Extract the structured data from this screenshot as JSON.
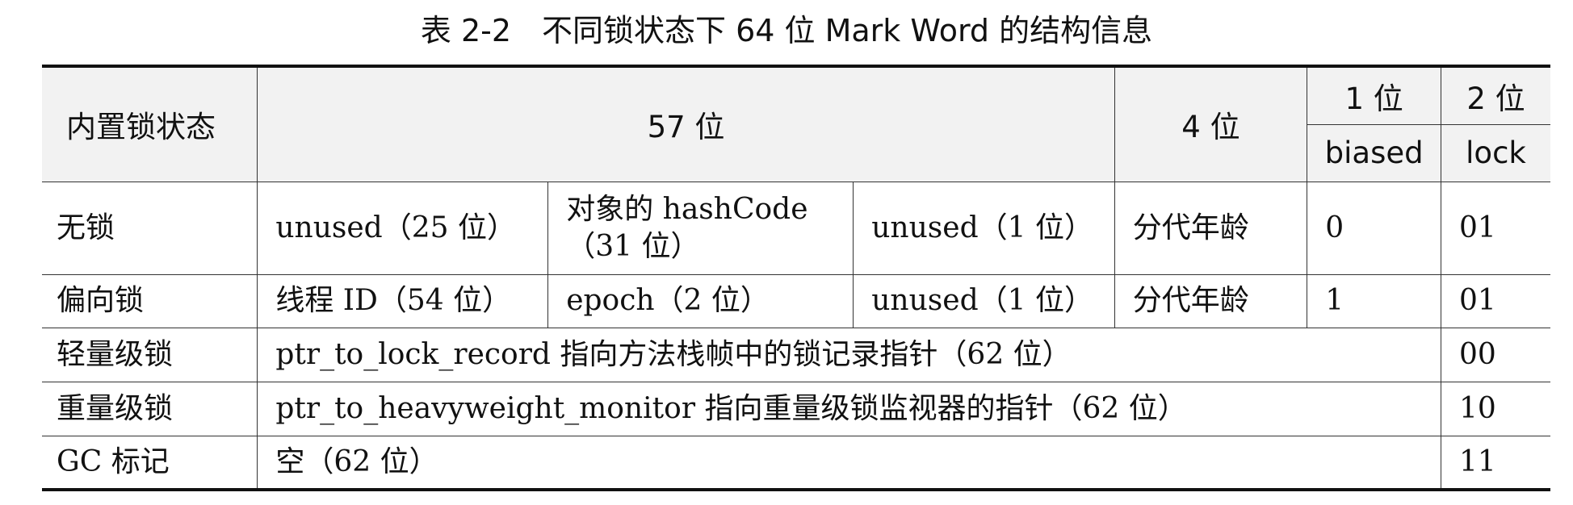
{
  "caption": "表 2-2　不同锁状态下 64 位 Mark Word 的结构信息",
  "header": {
    "state": "内置锁状态",
    "bits57": "57 位",
    "bits4": "4 位",
    "bits1": "1 位",
    "bits2": "2 位",
    "biased": "biased",
    "lock": "lock"
  },
  "rows": {
    "unlocked": {
      "state": "无锁",
      "unused25": "unused（25 位）",
      "hashcode": "对象的 hashCode（31 位）",
      "unused1": "unused（1 位）",
      "age": "分代年龄",
      "biased": "0",
      "lock": "01"
    },
    "biased": {
      "state": "偏向锁",
      "thread_id": "线程 ID（54 位）",
      "epoch": "epoch（2 位）",
      "unused1": "unused（1 位）",
      "age": "分代年龄",
      "biased": "1",
      "lock": "01"
    },
    "lightweight": {
      "state": "轻量级锁",
      "content": "ptr_to_lock_record 指向方法栈帧中的锁记录指针（62 位）",
      "lock": "00"
    },
    "heavyweight": {
      "state": "重量级锁",
      "content": "ptr_to_heavyweight_monitor 指向重量级锁监视器的指针（62 位）",
      "lock": "10"
    },
    "gc": {
      "state": "GC 标记",
      "content": "空（62 位）",
      "lock": "11"
    }
  }
}
